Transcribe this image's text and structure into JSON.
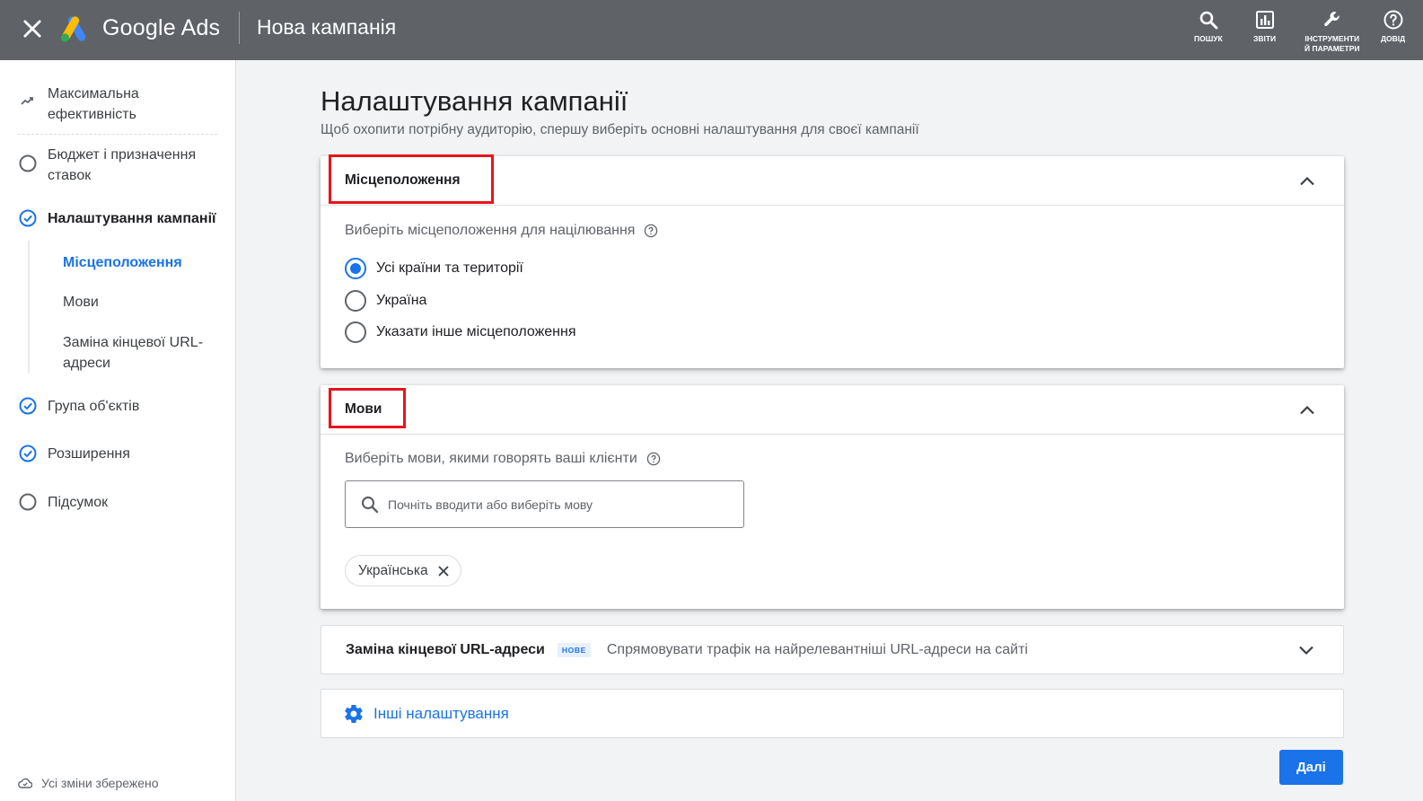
{
  "topbar": {
    "brand": "Google Ads",
    "page_title": "Нова кампанія",
    "actions": [
      {
        "label": "ПОШУК"
      },
      {
        "label": "ЗВІТИ"
      },
      {
        "label_line1": "ІНСТРУМЕНТИ",
        "label_line2": "Й ПАРАМЕТРИ"
      },
      {
        "label": "ДОВІД"
      }
    ]
  },
  "sidebar": {
    "goal": "Максимальна ефективність",
    "steps": [
      {
        "label": "Бюджет і призначення ставок",
        "status": "incomplete"
      },
      {
        "label": "Налаштування кампанії",
        "status": "complete"
      },
      {
        "label": "Група об'єктів",
        "status": "complete"
      },
      {
        "label": "Розширення",
        "status": "complete"
      },
      {
        "label": "Підсумок",
        "status": "incomplete"
      }
    ],
    "substeps": [
      "Місцеположення",
      "Мови",
      "Заміна кінцевої URL-адреси"
    ],
    "saved_status": "Усі зміни збережено"
  },
  "main": {
    "title": "Налаштування кампанії",
    "subtitle": "Щоб охопити потрібну аудиторію, спершу виберіть основні налаштування для своєї кампанії",
    "location": {
      "header": "Місцеположення",
      "question": "Виберіть місцеположення для націлювання",
      "options": [
        "Усі країни та території",
        "Україна",
        "Указати інше місцеположення"
      ],
      "selected_index": 0
    },
    "languages": {
      "header": "Мови",
      "question": "Виберіть мови, якими говорять ваші клієнти",
      "search_placeholder": "Почніть вводити або виберіть мову",
      "selected": [
        "Українська"
      ]
    },
    "url_expansion": {
      "title": "Заміна кінцевої URL-адреси",
      "badge": "НОВЕ",
      "description": "Спрямовувати трафік на найрелевантніші URL-адреси на сайті"
    },
    "other_settings": "Інші налаштування",
    "next_button": "Далі"
  },
  "colors": {
    "topbar": "#5f6368",
    "accent": "#1a73e8",
    "highlight": "#e8141c"
  }
}
